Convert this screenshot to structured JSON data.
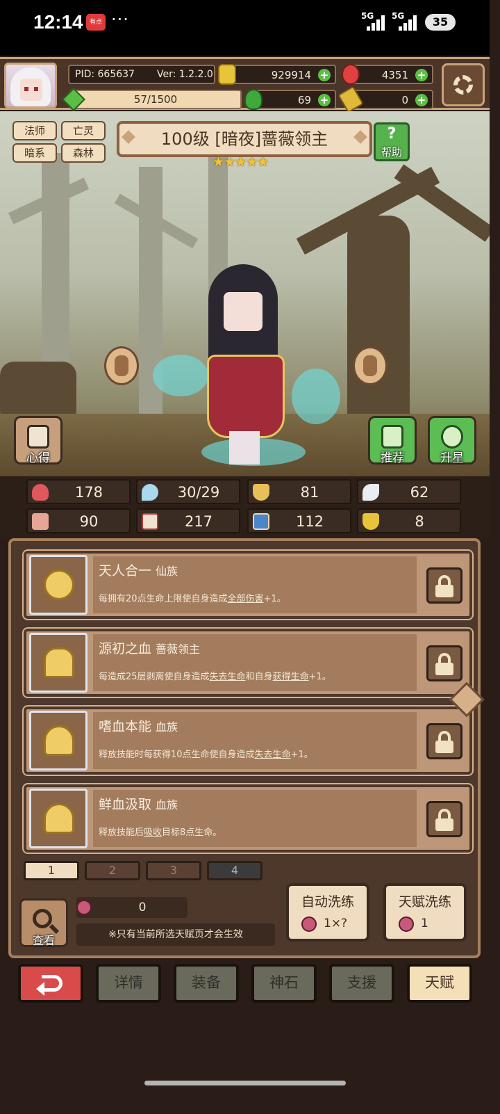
{
  "status_bar": {
    "time": "12:14",
    "app_badge": "有点",
    "more": "···",
    "signal_1": "5G",
    "signal_2": "5G",
    "battery": "35"
  },
  "player": {
    "pid": "PID: 665637",
    "version": "Ver: 1.2.2.0",
    "exp": "57/1500",
    "exp_fraction": 0.038
  },
  "resources": {
    "gold": "929914",
    "gems": "4351",
    "clover": "69",
    "keys": "0"
  },
  "hero": {
    "tags": [
      "法师",
      "亡灵",
      "暗系",
      "森林"
    ],
    "title": "100级  [暗夜]蔷薇领主",
    "stars": "★★★★★",
    "star_count": 5,
    "help_label": "帮助",
    "insight_label": "心得",
    "recommend_label": "推荐",
    "upgrade_star_label": "升星"
  },
  "stats": [
    {
      "icon": "heart-icon",
      "value": "178"
    },
    {
      "icon": "water-drop-icon",
      "value": "30/29"
    },
    {
      "icon": "shield-icon",
      "value": "81"
    },
    {
      "icon": "wing-icon",
      "value": "62"
    },
    {
      "icon": "fist-icon",
      "value": "90"
    },
    {
      "icon": "book-icon",
      "value": "217"
    },
    {
      "icon": "boot-icon",
      "value": "112"
    },
    {
      "icon": "horseshoe-icon",
      "value": "8"
    }
  ],
  "talents": [
    {
      "name": "天人合一",
      "race": "仙族",
      "desc_pre": "每拥有20点生命上限使自身造成",
      "desc_u1": "全部伤害",
      "desc_mid": "+1。",
      "desc_u2": "",
      "desc_post": ""
    },
    {
      "name": "源初之血",
      "race": "蔷薇领主",
      "desc_pre": "每造成25层剥离使自身造成",
      "desc_u1": "失去生命",
      "desc_mid": "和自身",
      "desc_u2": "获得生命",
      "desc_post": "+1。"
    },
    {
      "name": "嗜血本能",
      "race": "血族",
      "desc_pre": "释放技能时每获得10点生命使自身造成",
      "desc_u1": "失去生命",
      "desc_mid": "+1。",
      "desc_u2": "",
      "desc_post": ""
    },
    {
      "name": "鲜血汲取",
      "race": "血族",
      "desc_pre": "释放技能后",
      "desc_u1": "吸收",
      "desc_mid": "目标8点生命。",
      "desc_u2": "",
      "desc_post": ""
    }
  ],
  "pages": [
    "1",
    "2",
    "3",
    "4"
  ],
  "talent_points": "0",
  "note": "※只有当前所选天赋页才会生效",
  "view_label": "查看",
  "auto_refine": {
    "label": "自动洗练",
    "cost": "1×?"
  },
  "talent_refine": {
    "label": "天赋洗练",
    "cost": "1"
  },
  "nav": {
    "details": "详情",
    "equipment": "装备",
    "divine_stone": "神石",
    "support": "支援",
    "talent": "天赋"
  }
}
